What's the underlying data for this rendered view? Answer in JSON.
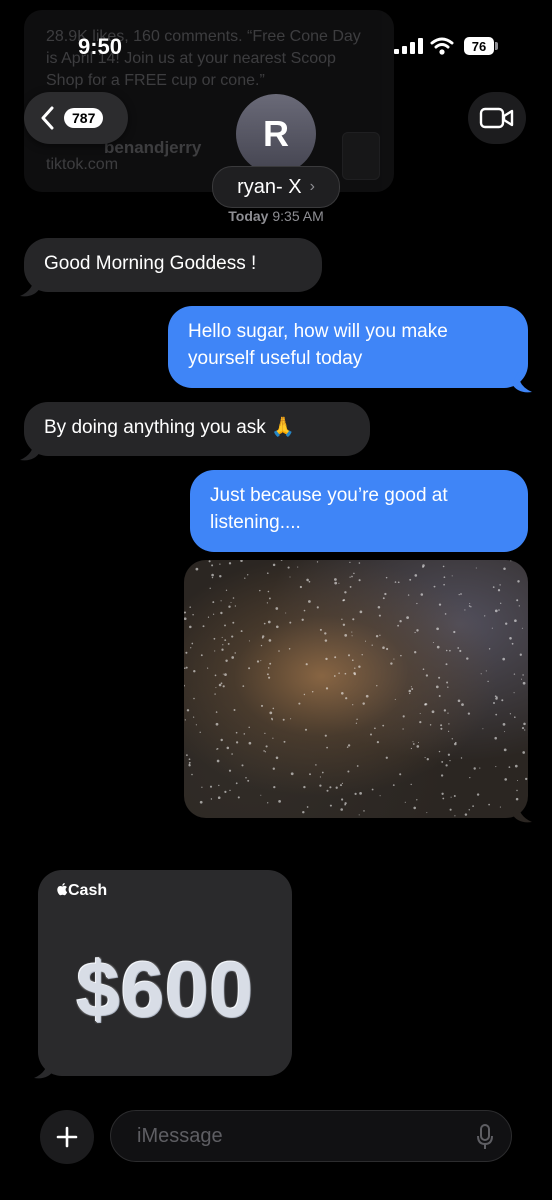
{
  "status_bar": {
    "time": "9:50",
    "battery": "76"
  },
  "background_preview": {
    "text": "28.9K likes, 160 comments. “Free Cone Day is April 14! Join us at your nearest Scoop Shop for a FREE cup or cone.”",
    "handle": "benandjerry",
    "domain": "tiktok.com"
  },
  "nav": {
    "back_badge": "787",
    "avatar_initial": "R",
    "contact_name": "ryan- X",
    "contact_chevron": "›"
  },
  "thread": {
    "timestamp_day": "Today",
    "timestamp_time": "9:35 AM",
    "messages": [
      {
        "direction": "incoming",
        "text": "Good Morning Goddess !"
      },
      {
        "direction": "outgoing",
        "text": "Hello sugar, how will you make yourself useful today"
      },
      {
        "direction": "incoming",
        "text": "By doing anything you ask 🙏"
      },
      {
        "direction": "outgoing",
        "text": "Just because you’re good at listening...."
      }
    ],
    "cash": {
      "brand": "Cash",
      "amount": "$600"
    }
  },
  "composer": {
    "placeholder": "iMessage"
  },
  "colors": {
    "outgoing_bubble": "#3f85f7",
    "incoming_bubble": "#262628",
    "background": "#000000"
  },
  "icons": [
    "back-chevron-icon",
    "video-camera-icon",
    "plus-icon",
    "microphone-icon",
    "signal-icon",
    "wifi-icon",
    "apple-logo-icon",
    "photo-attachment"
  ]
}
